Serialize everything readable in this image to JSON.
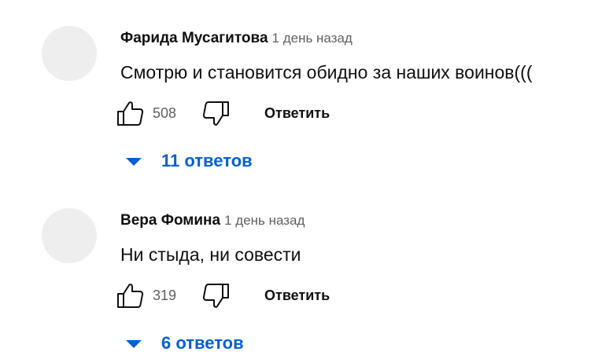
{
  "comments": [
    {
      "author": "Фарида Мусагитова",
      "time": "1 день назад",
      "text": "Смотрю и становится обидно за наших воинов(((",
      "likes": "508",
      "reply_label": "Ответить",
      "replies_label": "11 ответов"
    },
    {
      "author": "Вера Фомина",
      "time": "1 день назад",
      "text": "Ни стыда, ни совести",
      "likes": "319",
      "reply_label": "Ответить",
      "replies_label": "6 ответов"
    }
  ],
  "icons": {
    "like": "thumbs-up-icon",
    "dislike": "thumbs-down-icon",
    "expand": "caret-down-icon"
  },
  "colors": {
    "link": "#065fd4",
    "text": "#0f0f0f",
    "secondary": "#606060",
    "avatar": "#eeeeee"
  }
}
